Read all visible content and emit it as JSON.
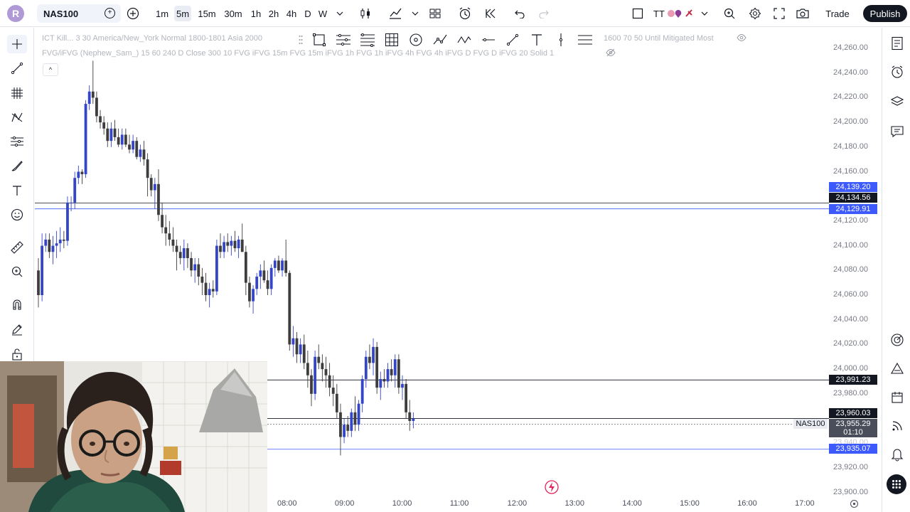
{
  "header": {
    "logo_letter": "R",
    "symbol": "NAS100",
    "timeframes": [
      "1m",
      "5m",
      "15m",
      "30m",
      "1h",
      "2h",
      "4h",
      "D",
      "W"
    ],
    "active_timeframe": "5m",
    "indicator_label": "TT",
    "trade_label": "Trade",
    "publish_label": "Publish"
  },
  "legend": {
    "line1_left": "ICT Kill... 3 30 America/New_York Normal 1800-1801 Asia 2000",
    "line1_right": "1600 70 50 Until Mitigated Most",
    "line2": "FVG/iFVG (Nephew_Sam_) 15 60 240 D Close 300 10 FVG iFVG 15m FVG 15m iFVG 1h FVG 1h iFVG 4h FVG 4h iFVG D FVG D iFVG 20 Solid 1"
  },
  "price_axis": {
    "ticks": [
      "24,260.00",
      "24,240.00",
      "24,220.00",
      "24,200.00",
      "24,180.00",
      "24,160.00",
      "24,120.00",
      "24,100.00",
      "24,080.00",
      "24,060.00",
      "24,040.00",
      "24,020.00",
      "24,000.00",
      "23,980.00",
      "23,920.00",
      "23,900.00"
    ],
    "faded_tick": "23,940.00",
    "labels": [
      {
        "text": "24,139.20",
        "color": "#3d5afe"
      },
      {
        "text": "24,134.56",
        "color": "#131722"
      },
      {
        "text": "24,129.91",
        "color": "#3d5afe"
      },
      {
        "text": "23,991.23",
        "color": "#131722"
      },
      {
        "text": "23,960.03",
        "color": "#131722"
      },
      {
        "text": "23,955.29",
        "color": "#4a4e5a"
      },
      {
        "text": "23,935.07",
        "color": "#3d5afe"
      }
    ],
    "countdown": "01:10",
    "symbol_tag": "NAS100"
  },
  "time_axis": {
    "ticks": [
      "08:00",
      "09:00",
      "10:00",
      "11:00",
      "12:00",
      "13:00",
      "14:00",
      "15:00",
      "16:00",
      "17:00"
    ]
  },
  "colors": {
    "up": "#3446c7",
    "down": "#3d3d3d",
    "accent": "#3d5afe",
    "publish_bg": "#131722"
  },
  "candles": [
    [
      24080,
      24090,
      24050,
      24060
    ],
    [
      24060,
      24110,
      24055,
      24100
    ],
    [
      24100,
      24110,
      24095,
      24105
    ],
    [
      24105,
      24110,
      24090,
      24095
    ],
    [
      24095,
      24108,
      24085,
      24100
    ],
    [
      24100,
      24112,
      24090,
      24102
    ],
    [
      24102,
      24115,
      24095,
      24105
    ],
    [
      24105,
      24112,
      24098,
      24104
    ],
    [
      24104,
      24140,
      24100,
      24135
    ],
    [
      24135,
      24140,
      24128,
      24135
    ],
    [
      24135,
      24160,
      24130,
      24155
    ],
    [
      24155,
      24165,
      24150,
      24160
    ],
    [
      24160,
      24162,
      24150,
      24158
    ],
    [
      24158,
      24218,
      24155,
      24215
    ],
    [
      24215,
      24230,
      24210,
      24225
    ],
    [
      24225,
      24250,
      24215,
      24220
    ],
    [
      24220,
      24225,
      24200,
      24205
    ],
    [
      24205,
      24210,
      24195,
      24200
    ],
    [
      24200,
      24205,
      24190,
      24195
    ],
    [
      24195,
      24200,
      24180,
      24185
    ],
    [
      24185,
      24200,
      24180,
      24195
    ],
    [
      24195,
      24202,
      24185,
      24188
    ],
    [
      24188,
      24195,
      24180,
      24182
    ],
    [
      24182,
      24195,
      24178,
      24190
    ],
    [
      24190,
      24195,
      24180,
      24182
    ],
    [
      24182,
      24190,
      24175,
      24178
    ],
    [
      24178,
      24190,
      24175,
      24185
    ],
    [
      24185,
      24188,
      24170,
      24172
    ],
    [
      24172,
      24182,
      24168,
      24178
    ],
    [
      24178,
      24185,
      24165,
      24170
    ],
    [
      24170,
      24175,
      24140,
      24155
    ],
    [
      24155,
      24158,
      24140,
      24145
    ],
    [
      24145,
      24155,
      24130,
      24150
    ],
    [
      24150,
      24162,
      24120,
      24125
    ],
    [
      24125,
      24135,
      24110,
      24115
    ],
    [
      24115,
      24125,
      24100,
      24110
    ],
    [
      24110,
      24120,
      24100,
      24105
    ],
    [
      24105,
      24115,
      24095,
      24100
    ],
    [
      24100,
      24105,
      24080,
      24095
    ],
    [
      24095,
      24100,
      24085,
      24090
    ],
    [
      24090,
      24105,
      24080,
      24098
    ],
    [
      24098,
      24102,
      24082,
      24090
    ],
    [
      24090,
      24095,
      24075,
      24080
    ],
    [
      24080,
      24090,
      24070,
      24085
    ],
    [
      24085,
      24090,
      24068,
      24075
    ],
    [
      24075,
      24082,
      24060,
      24070
    ],
    [
      24070,
      24078,
      24055,
      24060
    ],
    [
      24060,
      24070,
      24050,
      24065
    ],
    [
      24065,
      24072,
      24058,
      24063
    ],
    [
      24063,
      24105,
      24060,
      24100
    ],
    [
      24100,
      24110,
      24090,
      24095
    ],
    [
      24095,
      24108,
      24090,
      24103
    ],
    [
      24103,
      24110,
      24095,
      24100
    ],
    [
      24100,
      24108,
      24092,
      24104
    ],
    [
      24104,
      24112,
      24095,
      24098
    ],
    [
      24098,
      24108,
      24090,
      24105
    ],
    [
      24105,
      24118,
      24095,
      24095
    ],
    [
      24095,
      24100,
      24060,
      24070
    ],
    [
      24070,
      24075,
      24050,
      24055
    ],
    [
      24055,
      24068,
      24045,
      24065
    ],
    [
      24065,
      24078,
      24060,
      24075
    ],
    [
      24075,
      24085,
      24065,
      24080
    ],
    [
      24080,
      24088,
      24070,
      24072
    ],
    [
      24072,
      24080,
      24060,
      24065
    ],
    [
      24065,
      24085,
      24060,
      24082
    ],
    [
      24082,
      24090,
      24075,
      24088
    ],
    [
      24088,
      24092,
      24078,
      24080
    ],
    [
      24080,
      24090,
      24075,
      24088
    ],
    [
      24088,
      24105,
      24075,
      24078
    ],
    [
      24078,
      24080,
      24015,
      24020
    ],
    [
      24020,
      24035,
      24010,
      24025
    ],
    [
      24025,
      24030,
      24005,
      24012
    ],
    [
      24012,
      24025,
      24005,
      24020
    ],
    [
      24020,
      24028,
      24000,
      24005
    ],
    [
      24005,
      24015,
      23985,
      23995
    ],
    [
      23995,
      24000,
      23970,
      23980
    ],
    [
      23980,
      24015,
      23975,
      24010
    ],
    [
      24010,
      24020,
      24000,
      24005
    ],
    [
      24005,
      24012,
      23990,
      24000
    ],
    [
      24000,
      24010,
      23985,
      23995
    ],
    [
      23995,
      24005,
      23978,
      23985
    ],
    [
      23985,
      23995,
      23970,
      23980
    ],
    [
      23980,
      23988,
      23960,
      23965
    ],
    [
      23965,
      23972,
      23930,
      23945
    ],
    [
      23945,
      23960,
      23940,
      23955
    ],
    [
      23955,
      23962,
      23945,
      23950
    ],
    [
      23950,
      23968,
      23945,
      23965
    ],
    [
      23965,
      23978,
      23950,
      23955
    ],
    [
      23955,
      23975,
      23950,
      23972
    ],
    [
      23972,
      23995,
      23965,
      23992
    ],
    [
      23992,
      24015,
      23985,
      24010
    ],
    [
      24010,
      24020,
      24000,
      24005
    ],
    [
      24005,
      24025,
      23995,
      24018
    ],
    [
      24018,
      24022,
      23980,
      23985
    ],
    [
      23985,
      23998,
      23975,
      23992
    ],
    [
      23992,
      24000,
      23985,
      23990
    ],
    [
      23990,
      24005,
      23985,
      24000
    ],
    [
      24000,
      24008,
      23990,
      23995
    ],
    [
      23995,
      24012,
      23985,
      24008
    ],
    [
      24008,
      24012,
      23980,
      23985
    ],
    [
      23985,
      23995,
      23975,
      23988
    ],
    [
      23988,
      23992,
      23960,
      23965
    ],
    [
      23965,
      23975,
      23950,
      23958
    ],
    [
      23958,
      23965,
      23952,
      23960
    ]
  ]
}
